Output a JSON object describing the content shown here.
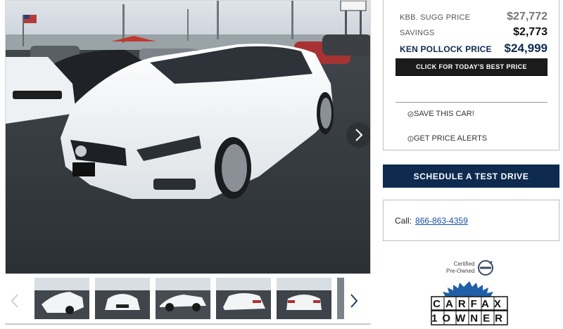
{
  "gallery": {
    "main_image_alt": "White Volvo sedan on dealer lot",
    "next_icon": "chevron-right-icon",
    "prev_icon": "chevron-left-icon",
    "thumbnails": [
      {
        "alt": "Front three-quarter view"
      },
      {
        "alt": "Front view"
      },
      {
        "alt": "Side view"
      },
      {
        "alt": "Rear three-quarter view"
      },
      {
        "alt": "Rear view"
      }
    ]
  },
  "pricing": {
    "kbb_label": "KBB. SUGG PRICE",
    "kbb_value": "$27,772",
    "savings_label": "SAVINGS",
    "savings_value": "$2,773",
    "dealer_label": "KEN POLLOCK PRICE",
    "dealer_value": "$24,999",
    "best_price_button": "CLICK FOR TODAY'S BEST PRICE",
    "save_label": "SAVE THIS CAR!",
    "alerts_label": "GET PRICE ALERTS"
  },
  "actions": {
    "schedule_button": "SCHEDULE A TEST DRIVE",
    "call_label": "Call:",
    "phone": "866-863-4359"
  },
  "badges": {
    "cpo_line1": "Certified",
    "cpo_line2": "Pre-Owned",
    "carfax_top": "CARFAX",
    "carfax_bottom": "1OWNER"
  },
  "colors": {
    "navy": "#0e2a4f",
    "link": "#1a4fa0",
    "price_text": "#0e2a4f"
  }
}
